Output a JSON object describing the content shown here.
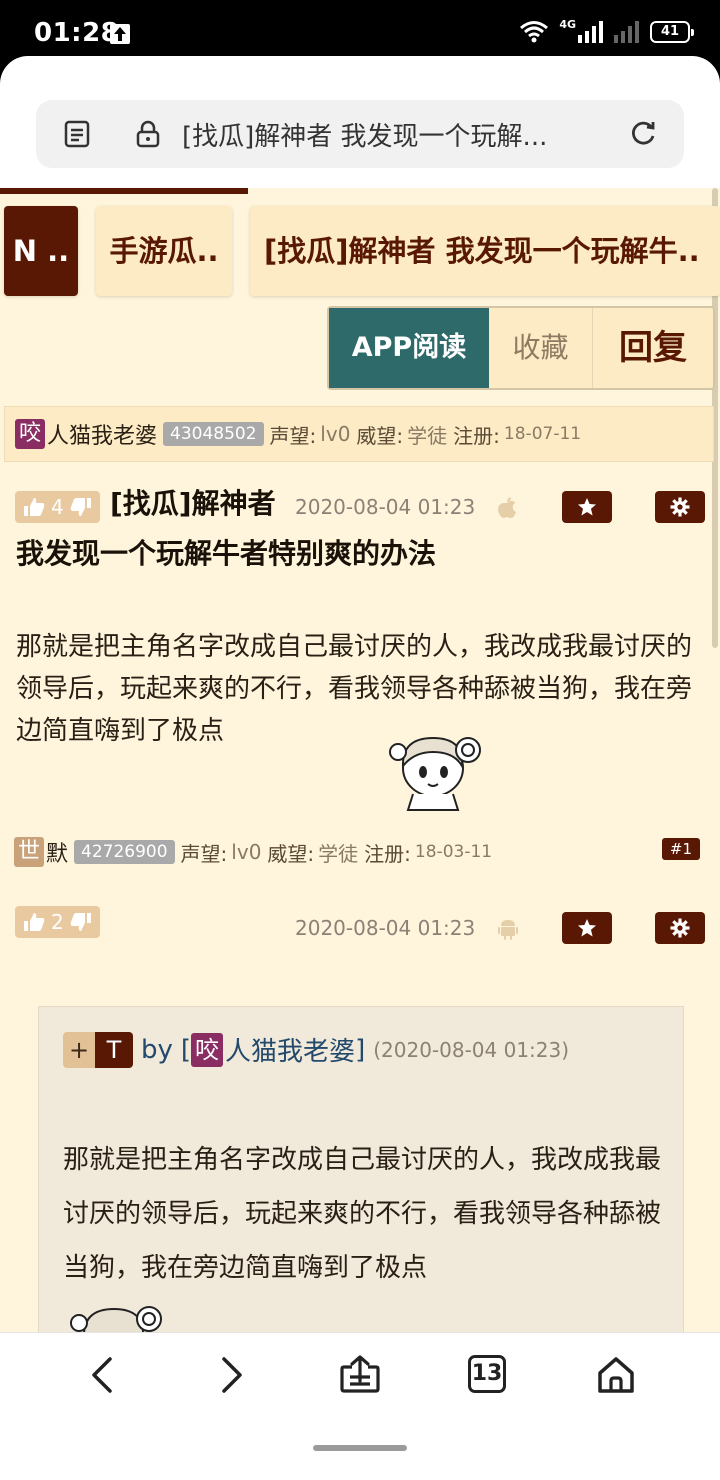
{
  "status_bar": {
    "time": "01:28",
    "network": "4G",
    "battery": "41"
  },
  "browser": {
    "url_text": "[找瓜]解神者 我发现一个玩解...",
    "tab_count": "13"
  },
  "nav": {
    "items": [
      "N ..",
      "手游瓜..",
      "[找瓜]解神者 我发现一个玩解牛.."
    ]
  },
  "actions": {
    "app_read": "APP阅读",
    "favorite": "收藏",
    "reply": "回复"
  },
  "labels": {
    "reputation": "声望:",
    "prestige": "威望:",
    "register": "注册:"
  },
  "post1": {
    "avatar_char": "咬",
    "avatar_color": "#8a2d63",
    "username": "人猫我老婆",
    "uid": "43048502",
    "reputation": "lv0",
    "prestige": "学徒",
    "register_date": "18-07-11",
    "likes": "4",
    "title_line1": "[找瓜]解神者",
    "title_line2": "我发现一个玩解牛者特别爽的办法",
    "time": "2020-08-04 01:23",
    "device_icon": "apple-icon",
    "body": "那就是把主角名字改成自己最讨厌的人，我改成我最讨厌的领导后，玩起来爽的不行，看我领导各种舔被当狗，我在旁边简直嗨到了极点"
  },
  "post2": {
    "avatar_char": "世",
    "avatar_color": "#c9a27a",
    "username": "默",
    "uid": "42726900",
    "reputation": "lv0",
    "prestige": "学徒",
    "register_date": "18-03-11",
    "floor": "#1",
    "likes": "2",
    "time": "2020-08-04 01:23",
    "device_icon": "android-icon",
    "quote": {
      "plus": "+",
      "tag": "T",
      "by": "by",
      "bracket_open": "[",
      "bracket_close": "]",
      "avatar_char": "咬",
      "author": "人猫我老婆",
      "time": "(2020-08-04 01:23)",
      "body": "那就是把主角名字改成自己最讨厌的人，我改成我最讨厌的领导后，玩起来爽的不行，看我领导各种舔被当狗，我在旁边简直嗨到了极点"
    }
  }
}
